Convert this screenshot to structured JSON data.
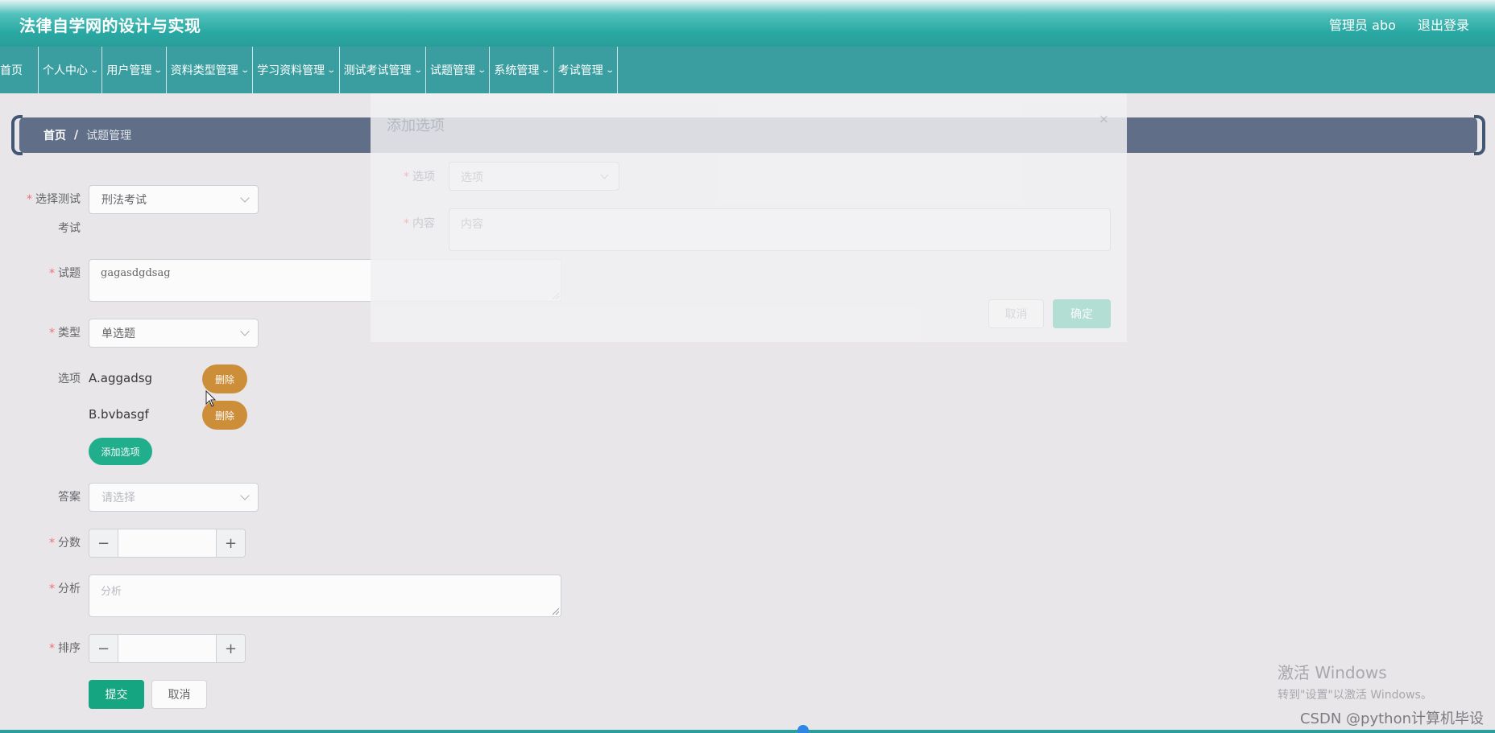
{
  "header": {
    "title": "法律自学网的设计与实现",
    "admin_label": "管理员 abo",
    "logout_label": "退出登录"
  },
  "nav": {
    "items": [
      "首页",
      "个人中心",
      "用户管理",
      "资料类型管理",
      "学习资料管理",
      "测试考试管理",
      "试题管理",
      "系统管理",
      "考试管理"
    ]
  },
  "breadcrumb": {
    "home": "首页",
    "separator": "/",
    "current": "试题管理"
  },
  "form": {
    "exam": {
      "label_line1": "选择测试",
      "label_line2": "考试",
      "value": "刑法考试"
    },
    "question": {
      "label": "试题",
      "value": "gagasdgdsag"
    },
    "type": {
      "label": "类型",
      "value": "单选题"
    },
    "options": {
      "label": "选项",
      "items": [
        "A.aggadsg",
        "B.bvbasgf"
      ],
      "delete_label": "删除",
      "add_label": "添加选项"
    },
    "answer": {
      "label": "答案",
      "placeholder": "请选择"
    },
    "score": {
      "label": "分数",
      "minus": "−",
      "plus": "+"
    },
    "analysis": {
      "label": "分析",
      "placeholder": "分析"
    },
    "order": {
      "label": "排序",
      "minus": "−",
      "plus": "+"
    },
    "submit_label": "提交",
    "cancel_label": "取消"
  },
  "dialog": {
    "title": "添加选项",
    "close": "×",
    "option_label": "选项",
    "option_placeholder": "选项",
    "content_label": "内容",
    "content_placeholder": "内容",
    "cancel_label": "取消",
    "confirm_label": "确定"
  },
  "overlay": {
    "windows_line1": "激活 Windows",
    "windows_line2": "转到\"设置\"以激活 Windows。",
    "watermark": "CSDN @python计算机毕设"
  },
  "colors": {
    "header_teal": "#29a8a3",
    "nav_teal": "#3a9ea0",
    "breadcrumb_bg": "#5c6c85",
    "delete_orange": "#cf8d33",
    "add_green": "#19ae8c",
    "submit_green": "#0ea57f",
    "required_red": "#f56c6c"
  }
}
